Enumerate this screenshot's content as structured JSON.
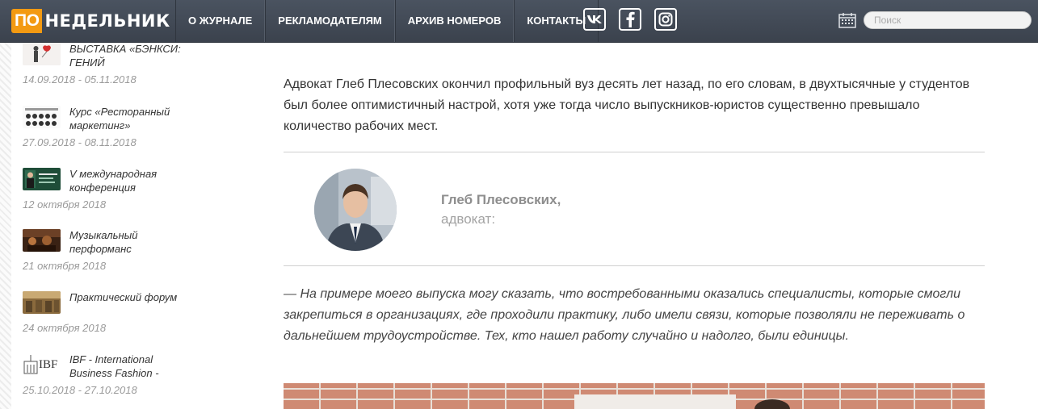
{
  "header": {
    "logo_prefix": "ПО",
    "logo_rest": "НЕДЕЛЬНИК",
    "nav": [
      "О ЖУРНАЛЕ",
      "РЕКЛАМОДАТЕЛЯМ",
      "АРХИВ НОМЕРОВ",
      "КОНТАКТЫ"
    ],
    "social": {
      "vk": "vk-icon",
      "facebook": "facebook-icon",
      "instagram": "instagram-icon"
    },
    "search_placeholder": "Поиск",
    "accent": "#f39a12"
  },
  "sidebar": {
    "events": [
      {
        "title": "ВЫСТАВКА «БЭНКСИ: ГЕНИЙ",
        "date": "14.09.2018 - 05.11.2018"
      },
      {
        "title": "Курс «Ресторанный маркетинг»",
        "date": "27.09.2018 - 08.11.2018"
      },
      {
        "title": "V международная конференция",
        "date": "12 октября 2018"
      },
      {
        "title": "Музыкальный перформанс",
        "date": "21 октября 2018"
      },
      {
        "title": "Практический форум",
        "date": "24 октября 2018"
      },
      {
        "title": "IBF - International Business Fashion -",
        "date": "25.10.2018 - 27.10.2018",
        "thumb_text": "IBF"
      }
    ]
  },
  "article": {
    "paragraph": "Адвокат Глеб Плесовских окончил профильный вуз десять лет назад, по его словам, в двухтысячные у студентов был более оптимистичный настрой, хотя уже тогда число выпускников-юристов существенно превышало количество рабочих мест.",
    "author_name": "Глеб Плесовских,",
    "author_role": "адвокат:",
    "quote": "— На примере моего выпуска могу сказать, что востребованными оказались специалисты, которые смогли закрепиться в организациях, где проходили практику, либо имели связи, которые позволяли не переживать о дальнейшем трудоустройстве. Тех, кто нашел работу случайно и надолго, были единицы."
  }
}
